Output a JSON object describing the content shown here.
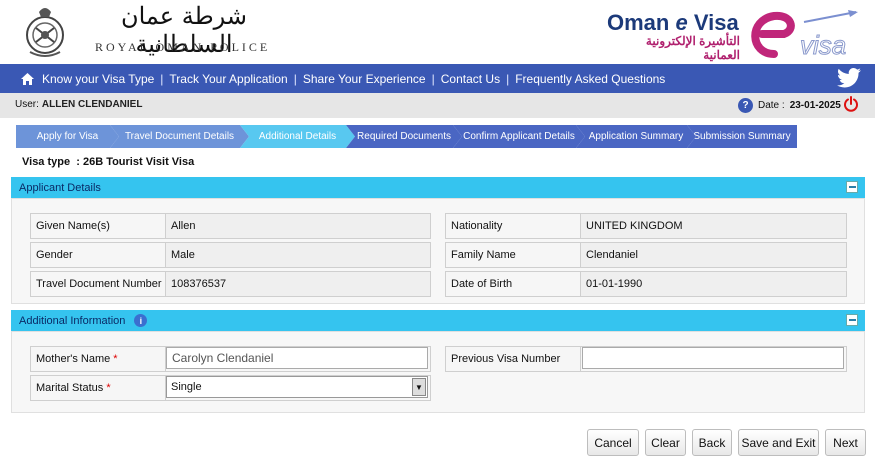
{
  "header": {
    "arabic_title": "شرطة عمان السلطانية",
    "royal_oman_police": "ROYAL OMAN POLICE",
    "evisa_title_left": "Oman ",
    "evisa_title_e": "e",
    "evisa_title_right": " Visa",
    "evisa_arabic": "التأشيرة الإلكترونية العمانية",
    "logo_text": "visa",
    "brand_colors": {
      "navy": "#1c3a7a",
      "magenta": "#b0206e",
      "nav_blue": "#3a58b4"
    }
  },
  "nav": {
    "home_icon": "home-icon",
    "items": [
      "Know your Visa Type",
      "Track Your Application",
      "Share Your Experience",
      "Contact Us",
      "Frequently Asked Questions"
    ],
    "separator": "|",
    "twitter_icon": "twitter-icon"
  },
  "userbar": {
    "user_label": "User:",
    "user_name": "ALLEN CLENDANIEL",
    "date_label": "Date :",
    "date_value": "23-01-2025",
    "help_icon": "?"
  },
  "steps": [
    "Apply for Visa",
    "Travel Document Details",
    "Additional Details",
    "Required Documents",
    "Confirm Applicant Details",
    "Application Summary",
    "Submission Summary"
  ],
  "visa_type": {
    "label": "Visa type",
    "value": ": 26B Tourist Visit Visa"
  },
  "applicant": {
    "heading": "Applicant Details",
    "fields": [
      {
        "label": "Given Name(s)",
        "value": "Allen"
      },
      {
        "label": "Nationality",
        "value": "UNITED KINGDOM"
      },
      {
        "label": "Gender",
        "value": "Male"
      },
      {
        "label": "Family Name",
        "value": "Clendaniel"
      },
      {
        "label": "Travel Document Number",
        "value": "108376537"
      },
      {
        "label": "Date of Birth",
        "value": "01-01-1990"
      }
    ]
  },
  "additional": {
    "heading": "Additional Information",
    "mothers_name_label": "Mother's Name",
    "mothers_name_value": "Carolyn Clendaniel",
    "previous_visa_label": "Previous Visa Number",
    "previous_visa_value": "",
    "marital_status_label": "Marital Status",
    "marital_status_value": "Single",
    "required_mark": "*"
  },
  "buttons": {
    "cancel": "Cancel",
    "clear": "Clear",
    "back": "Back",
    "save_exit": "Save and Exit",
    "next": "Next"
  }
}
